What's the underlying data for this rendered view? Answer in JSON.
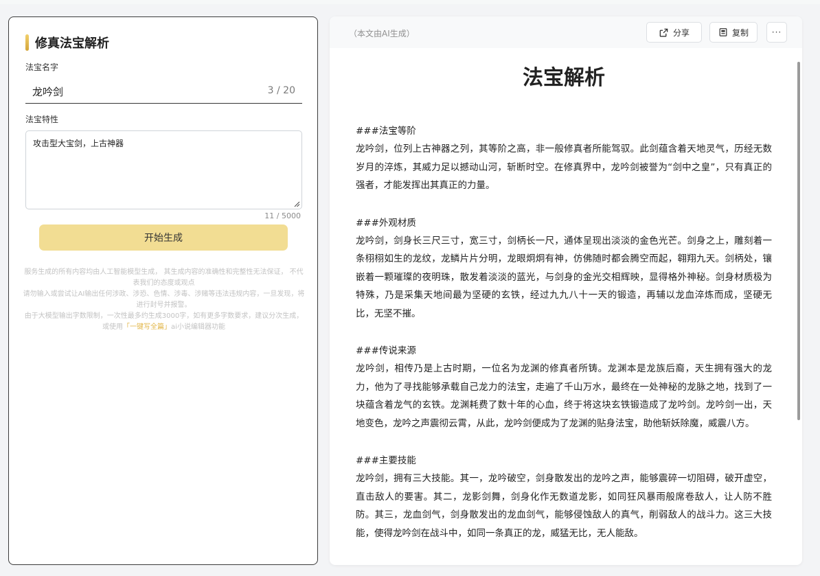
{
  "form": {
    "title": "修真法宝解析",
    "name_label": "法宝名字",
    "name_value": "龙吟剑",
    "name_count": "3 / 20",
    "trait_label": "法宝特性",
    "trait_value": "攻击型大宝剑，上古神器",
    "trait_count": "11 / 5000",
    "generate_label": "开始生成",
    "disclaimer": {
      "line1": "服务生成的所有内容均由人工智能模型生成， 其生成内容的准确性和完整性无法保证， 不代表我们的态度或观点",
      "line2": "请勿输入或尝试让AI输出任何涉政、涉恐、色情、涉毒、涉赌等违法违规内容，一旦发现，将进行封号并报警。",
      "line3_pre": "由于大模型输出字数限制，一次性最多约生成3000字，如有更多字数要求，建议分次生成，或使用",
      "line3_link": "「一键写全篇」",
      "line3_post": "ai小说编辑器功能"
    }
  },
  "result": {
    "ai_note": "（本文由AI生成）",
    "share_label": "分享",
    "copy_label": "复制",
    "more_label": "···",
    "title": "法宝解析",
    "sections": [
      {
        "heading": "###法宝等阶",
        "body": "龙吟剑，位列上古神器之列，其等阶之高，非一般修真者所能驾驭。此剑蕴含着天地灵气，历经无数岁月的淬炼，其威力足以撼动山河，斩断时空。在修真界中，龙吟剑被誉为“剑中之皇”，只有真正的强者，才能发挥出其真正的力量。"
      },
      {
        "heading": "###外观材质",
        "body": "龙吟剑，剑身长三尺三寸，宽三寸，剑柄长一尺，通体呈现出淡淡的金色光芒。剑身之上，雕刻着一条栩栩如生的龙纹，龙鳞片片分明，龙眼炯炯有神，仿佛随时都会腾空而起，翱翔九天。剑柄处，镶嵌着一颗璀璨的夜明珠，散发着淡淡的蓝光，与剑身的金光交相辉映，显得格外神秘。剑身材质极为特殊，乃是采集天地间最为坚硬的玄铁，经过九九八十一天的锻造，再辅以龙血淬炼而成，坚硬无比，无坚不摧。"
      },
      {
        "heading": "###传说来源",
        "body": "龙吟剑，相传乃是上古时期，一位名为龙渊的修真者所铸。龙渊本是龙族后裔，天生拥有强大的龙力，他为了寻找能够承载自己龙力的法宝，走遍了千山万水，最终在一处神秘的龙脉之地，找到了一块蕴含着龙气的玄铁。龙渊耗费了数十年的心血，终于将这块玄铁锻造成了龙吟剑。龙吟剑一出，天地变色，龙吟之声震彻云霄，从此，龙吟剑便成为了龙渊的贴身法宝，助他斩妖除魔，威震八方。"
      },
      {
        "heading": "###主要技能",
        "body": "龙吟剑，拥有三大技能。其一，龙吟破空，剑身散发出的龙吟之声，能够震碎一切阻碍，破开虚空，直击敌人的要害。其二，龙影剑舞，剑身化作无数道龙影，如同狂风暴雨般席卷敌人，让人防不胜防。其三，龙血剑气，剑身散发出的龙血剑气，能够侵蚀敌人的真气，削弱敌人的战斗力。这三大技能，使得龙吟剑在战斗中，如同一条真正的龙，威猛无比，无人能敌。"
      }
    ]
  }
}
